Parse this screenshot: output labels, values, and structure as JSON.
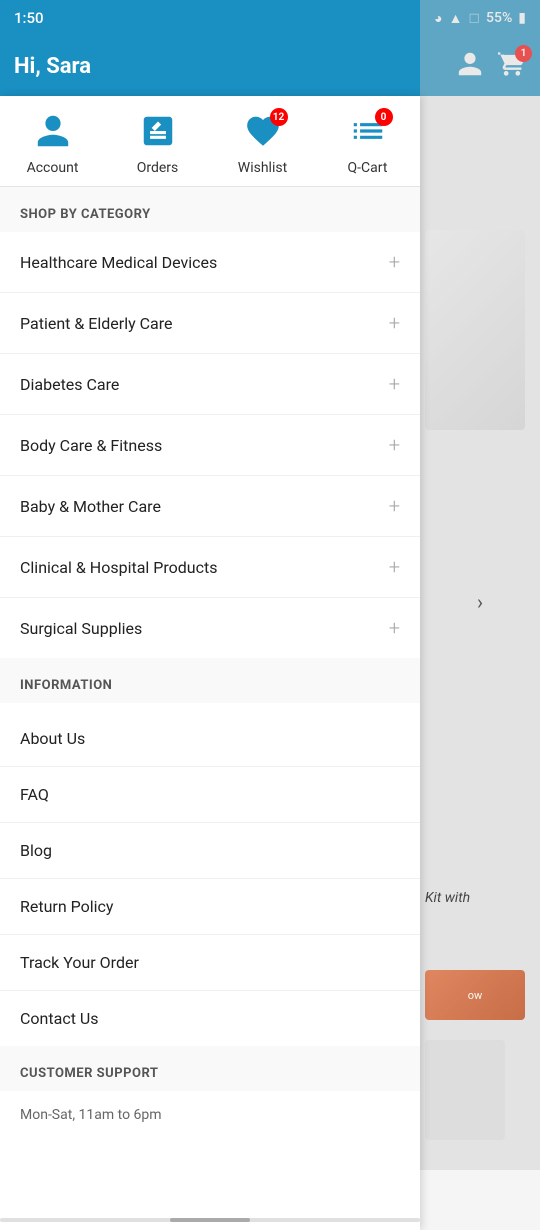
{
  "statusBar": {
    "time": "1:50",
    "battery": "55%"
  },
  "header": {
    "greeting": "Hi, Sara",
    "cartBadge": "1"
  },
  "quickNav": {
    "items": [
      {
        "id": "account",
        "label": "Account",
        "badge": null
      },
      {
        "id": "orders",
        "label": "Orders",
        "badge": null
      },
      {
        "id": "wishlist",
        "label": "Wishlist",
        "badge": "12"
      },
      {
        "id": "qcart",
        "label": "Q-Cart",
        "badge": "0"
      }
    ]
  },
  "shopByCategory": {
    "heading": "SHOP BY CATEGORY",
    "items": [
      {
        "id": "healthcare-medical-devices",
        "label": "Healthcare Medical Devices"
      },
      {
        "id": "patient-elderly-care",
        "label": "Patient & Elderly Care"
      },
      {
        "id": "diabetes-care",
        "label": "Diabetes Care"
      },
      {
        "id": "body-care-fitness",
        "label": "Body Care & Fitness"
      },
      {
        "id": "baby-mother-care",
        "label": "Baby & Mother Care"
      },
      {
        "id": "clinical-hospital-products",
        "label": "Clinical & Hospital Products"
      },
      {
        "id": "surgical-supplies",
        "label": "Surgical Supplies"
      }
    ]
  },
  "information": {
    "heading": "INFORMATION",
    "items": [
      {
        "id": "about-us",
        "label": "About Us"
      },
      {
        "id": "faq",
        "label": "FAQ"
      },
      {
        "id": "blog",
        "label": "Blog"
      },
      {
        "id": "return-policy",
        "label": "Return Policy"
      },
      {
        "id": "track-your-order",
        "label": "Track Your Order"
      },
      {
        "id": "contact-us",
        "label": "Contact Us"
      }
    ]
  },
  "customerSupport": {
    "heading": "CUSTOMER SUPPORT",
    "hours": "Mon-Sat, 11am to 6pm"
  }
}
